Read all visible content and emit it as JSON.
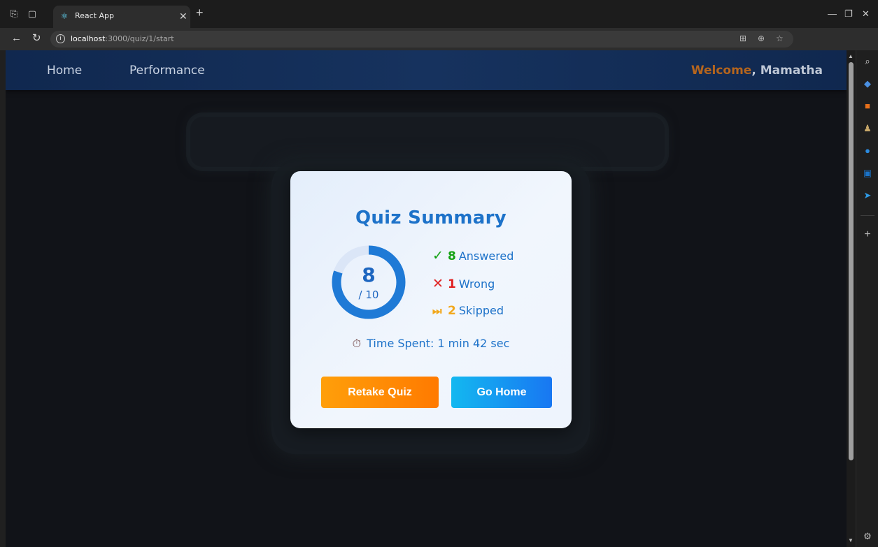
{
  "browser": {
    "tab_title": "React App",
    "tab_favicon": "react-icon",
    "new_tab": "+",
    "url_host": "localhost",
    "url_rest": ":3000/quiz/1/start",
    "window_controls": [
      "minimize",
      "restore",
      "close"
    ]
  },
  "app": {
    "nav": {
      "home": "Home",
      "performance": "Performance"
    },
    "welcome_word": "Welcome",
    "welcome_rest": ", Mamatha"
  },
  "summary": {
    "title": "Quiz Summary",
    "score": "8",
    "total": "/ 10",
    "score_fraction": 0.8,
    "answered": {
      "symbol": "✓",
      "count": "8",
      "label": "Answered",
      "color": "#12a112"
    },
    "wrong": {
      "symbol": "✕",
      "count": "1",
      "label": "Wrong",
      "color": "#e02020"
    },
    "skipped": {
      "symbol": "⏭",
      "count": "2",
      "label": "Skipped",
      "color": "#f2a81d"
    },
    "time_spent": "Time Spent: 1 min 42 sec",
    "retake_label": "Retake Quiz",
    "home_label": "Go Home"
  },
  "colors": {
    "accent": "#1d72c9",
    "ring_fill": "#1f7ad6",
    "ring_track": "#dbe6f7",
    "retake": "#ff8c00",
    "home": "#1890ff"
  }
}
